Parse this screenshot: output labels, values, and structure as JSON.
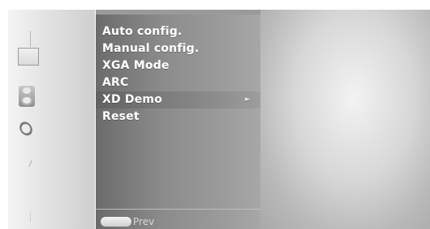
{
  "menu": {
    "items": [
      {
        "label": "Auto config.",
        "selected": false,
        "has_submenu": false
      },
      {
        "label": "Manual config.",
        "selected": false,
        "has_submenu": false
      },
      {
        "label": "XGA Mode",
        "selected": false,
        "has_submenu": false
      },
      {
        "label": "ARC",
        "selected": false,
        "has_submenu": false
      },
      {
        "label": "XD Demo",
        "selected": true,
        "has_submenu": true
      },
      {
        "label": "Reset",
        "selected": false,
        "has_submenu": false
      }
    ],
    "submenu_arrow_glyph": "►"
  },
  "footer": {
    "prev_label": "Prev"
  },
  "icons": [
    "screen-icon",
    "speaker-icon",
    "ring-icon"
  ],
  "colors": {
    "menu_text": "#ffffff",
    "panel": "#8b8b8b",
    "rail": "#e6e6e6"
  }
}
